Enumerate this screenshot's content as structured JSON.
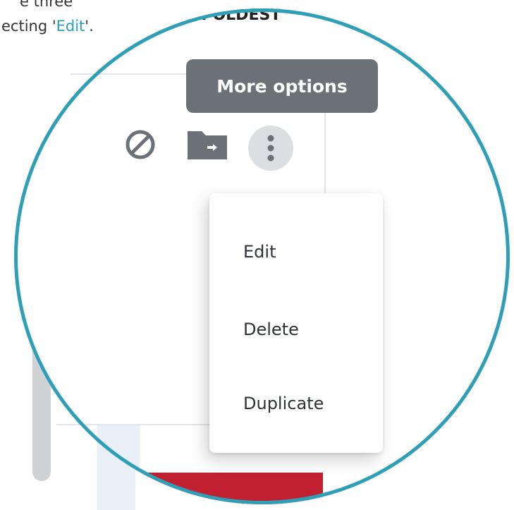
{
  "instruction": {
    "line1": "e three",
    "line2_prefix": "ecting '",
    "line2_link": "Edit",
    "line2_suffix": "'."
  },
  "sort": {
    "label": ": OLDEST"
  },
  "tooltip": {
    "text": "More options"
  },
  "actions": {
    "block_icon": "block-icon",
    "move_to_folder_icon": "folder-move-icon",
    "more_options_icon": "more-vert-icon"
  },
  "menu": {
    "items": [
      {
        "label": "Edit"
      },
      {
        "label": "Delete"
      },
      {
        "label": "Duplicate"
      }
    ]
  },
  "colors": {
    "ring": "#2e9fb6",
    "accent_link": "#2a9fb8",
    "tooltip_bg": "#6b7176",
    "icon_gray": "#6b7176",
    "red_block": "#c0202f"
  }
}
